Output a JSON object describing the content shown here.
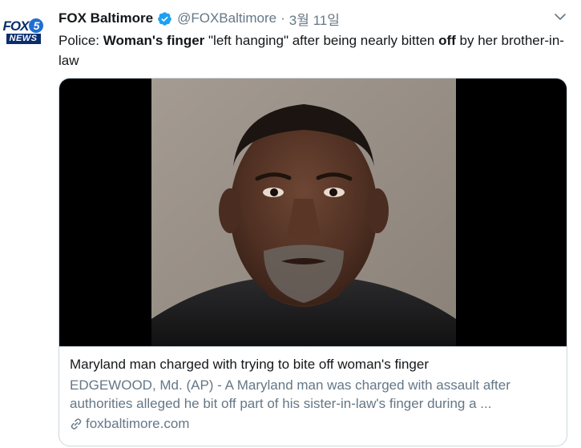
{
  "author": {
    "name": "FOX Baltimore",
    "handle": "@FOXBaltimore",
    "separator": "·",
    "date": "3월 11일",
    "verified_icon": "verified-badge-icon",
    "avatar_logo_top": "FOX",
    "avatar_logo_number": "5",
    "avatar_logo_bottom": "NEWS"
  },
  "tweet": {
    "text_1": "Police: ",
    "text_2": "Woman's finger",
    "text_3": " \"left hanging\" after being nearly bitten ",
    "text_4": "off",
    "text_5": " by her brother-in-law"
  },
  "card": {
    "title": "Maryland man charged with trying to bite off woman's finger",
    "description": "EDGEWOOD, Md. (AP) - A Maryland man was charged with assault after authorities alleged he bit off part of his sister-in-law's finger during a ...",
    "domain": "foxbaltimore.com",
    "image_icon": "mugshot-photo",
    "link_icon": "link-icon"
  },
  "colors": {
    "accent": "#1da1f2",
    "text": "#14171a",
    "muted": "#657786",
    "border": "#ccd6dd"
  }
}
